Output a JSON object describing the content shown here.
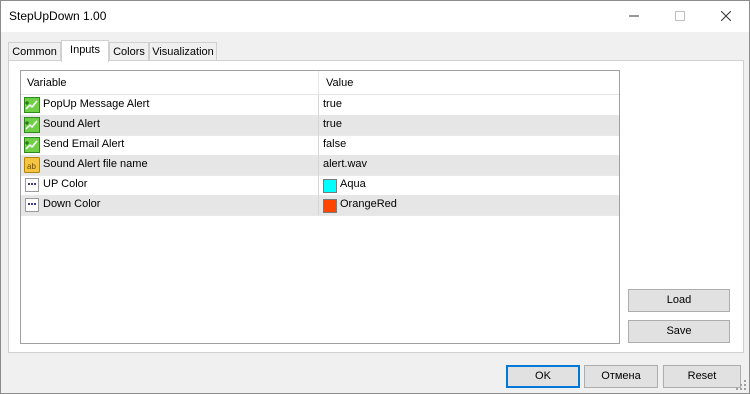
{
  "window": {
    "title": "StepUpDown 1.00"
  },
  "title_buttons": {
    "minimize": "—",
    "maximize": "☐",
    "close": "✕"
  },
  "tabs": [
    {
      "label": "Common"
    },
    {
      "label": "Inputs"
    },
    {
      "label": "Colors"
    },
    {
      "label": "Visualization"
    }
  ],
  "active_tab": "Inputs",
  "grid": {
    "headers": {
      "variable": "Variable",
      "value": "Value"
    },
    "rows": [
      {
        "name": "PopUp Message Alert",
        "value": "true",
        "icon": "bool-icon"
      },
      {
        "name": "Sound Alert",
        "value": "true",
        "icon": "bool-icon"
      },
      {
        "name": "Send Email Alert",
        "value": "false",
        "icon": "bool-icon"
      },
      {
        "name": "Sound Alert file name",
        "value": "alert.wav",
        "icon": "string-icon"
      },
      {
        "name": "UP Color",
        "value": "Aqua",
        "icon": "color-icon",
        "swatch": "#00ffff"
      },
      {
        "name": "Down Color",
        "value": "OrangeRed",
        "icon": "color-icon",
        "swatch": "#ff4500"
      }
    ]
  },
  "buttons": {
    "load": "Load",
    "save": "Save",
    "ok": "OK",
    "cancel": "Отмена",
    "reset": "Reset"
  },
  "colors": {
    "aqua": "#00ffff",
    "orangered": "#ff4500",
    "accent": "#0078d7"
  }
}
